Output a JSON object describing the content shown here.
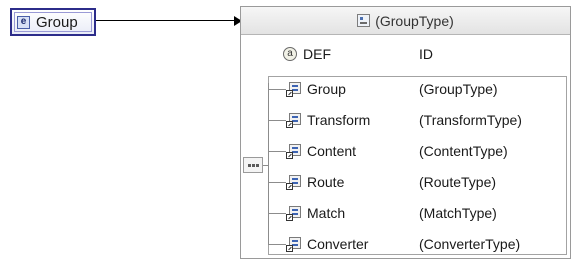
{
  "root_element": {
    "label": "Group",
    "icon": "element-icon"
  },
  "type_box": {
    "title": "(GroupType)",
    "title_icon": "complex-type-icon",
    "attribute": {
      "name": "DEF",
      "type": "ID",
      "icon": "attribute-icon",
      "icon_glyph": "a"
    },
    "compositor": {
      "kind": "sequence",
      "icon": "sequence-icon"
    },
    "children": [
      {
        "name": "Group",
        "type": "(GroupType)",
        "icon": "element-ref-icon"
      },
      {
        "name": "Transform",
        "type": "(TransformType)",
        "icon": "element-ref-icon"
      },
      {
        "name": "Content",
        "type": "(ContentType)",
        "icon": "element-ref-icon"
      },
      {
        "name": "Route",
        "type": "(RouteType)",
        "icon": "element-ref-icon"
      },
      {
        "name": "Match",
        "type": "(MatchType)",
        "icon": "element-ref-icon"
      },
      {
        "name": "Converter",
        "type": "(ConverterType)",
        "icon": "element-ref-icon"
      }
    ]
  },
  "colors": {
    "root_border": "#2c2c8a",
    "header_bg": "#e3e3e3",
    "line": "#8c8c8c"
  }
}
